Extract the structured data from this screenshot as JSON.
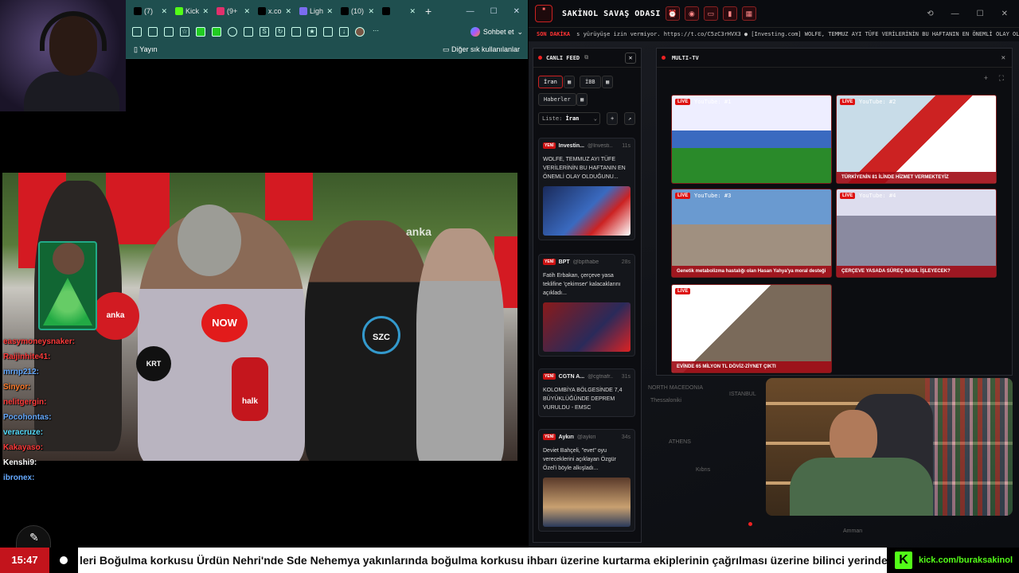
{
  "browser": {
    "tabs": [
      {
        "icon": "x-logo-icon",
        "label": "(7)",
        "color": "#000"
      },
      {
        "icon": "kick-icon",
        "label": "Kick",
        "color": "#53fc18"
      },
      {
        "icon": "instagram-icon",
        "label": "(9+",
        "color": "#e1306c"
      },
      {
        "icon": "x-logo-icon",
        "label": "x.co",
        "color": "#000"
      },
      {
        "icon": "feather-icon",
        "label": "Ligh",
        "color": "#7a6cf0"
      },
      {
        "icon": "x-logo-icon",
        "label": "(10)",
        "color": "#000"
      },
      {
        "icon": "x-logo-icon",
        "label": "",
        "color": "#000"
      }
    ],
    "new_tab": "+",
    "sohbet_label": "Sohbet et",
    "bookmark_left": "Yayın",
    "bookmark_right": "Diğer sık kullanılanlar"
  },
  "video": {
    "watermark": "anka",
    "mics": [
      "NOW",
      "halk",
      "SZC",
      "KRT",
      "anka"
    ]
  },
  "chat": [
    {
      "user": "easymoneysnaker:",
      "color": "#ff3b3b"
    },
    {
      "user": "Raijinhite41:",
      "color": "#ff3b3b"
    },
    {
      "user": "mrnp212:",
      "color": "#66aaff"
    },
    {
      "user": "Sinyor:",
      "color": "#ff7a2a"
    },
    {
      "user": "nelitgergin:",
      "color": "#ff3b3b"
    },
    {
      "user": "Pocohontas:",
      "color": "#66aaff"
    },
    {
      "user": "veracruze:",
      "color": "#55ddff"
    },
    {
      "user": "Kakayaso:",
      "color": "#ff3b3b"
    },
    {
      "user": "Kenshi9:",
      "color": "#ffffff"
    },
    {
      "user": "ibronex:",
      "color": "#66aaff"
    }
  ],
  "app": {
    "title": "SAKİNOL SAVAŞ ODASI",
    "ticker_label": "SON DAKİKA",
    "ticker_text": "s yürüyüşe izin vermiyor. https://t.co/C5zC3rHVX3   ● [Investing.com] WOLFE, TEMMUZ AYI TÜFE VERİLERİNİN BU HAFTANIN EN ÖNEMLİ OLAY OLDUĞUNU",
    "feed": {
      "title": "CANLI FEED",
      "chips": [
        "İran",
        "İBB",
        "Haberler"
      ],
      "list_label": "Liste:",
      "list_value": "İran",
      "cards": [
        {
          "source": "Investin...",
          "handle": "@Investi...",
          "time": "11s",
          "badge": "YENİ",
          "text": "WOLFE, TEMMUZ AYI TÜFE VERİLERİNİN BU HAFTANIN EN ÖNEMLİ OLAY OLDUĞUNU..."
        },
        {
          "source": "BPT",
          "handle": "@bpthaber",
          "time": "28s",
          "badge": "YENİ",
          "text": "Fatih Erbakan, çerçeve yasa teklifine 'çekimser' kalacaklarını açıkladı..."
        },
        {
          "source": "CGTN A...",
          "handle": "@cgtnafr...",
          "time": "31s",
          "badge": "YENİ",
          "text": "KOLOMBİYA BÖLGESİNDE 7,4 BÜYÜKLÜĞÜNDE DEPREM VURULDU - EMSC"
        },
        {
          "source": "Aykırı",
          "handle": "@aykiri",
          "time": "34s",
          "badge": "YENİ",
          "text": "Deviet Bahçeli, \"evet\" oyu vereceklerini açıklayan Özgür Özel'i böyle alkışladı..."
        }
      ]
    },
    "multitv": {
      "title": "MULTI-TV",
      "tiles": [
        {
          "live": "LIVE",
          "title": "YouTube: #1",
          "caption": ""
        },
        {
          "live": "LIVE",
          "title": "YouTube: #2",
          "caption": "TÜRKİYENİN 81 İLİNDE HİZMET VERMEKTEYİZ"
        },
        {
          "live": "LIVE",
          "title": "YouTube: #3",
          "caption": "Genetik metabolizma hastalığı olan Hasan Yahya'ya moral desteği"
        },
        {
          "live": "LIVE",
          "title": "YouTube: #4",
          "caption": "ÇERÇEVE YASADA SÜREÇ NASIL İŞLEYECEK?"
        },
        {
          "live": "LIVE",
          "title": "YouTube: #5",
          "caption": "EVİNDE 65 MİLYON TL DÖVİZ-ZİYNET ÇIKTI"
        }
      ]
    },
    "map_labels": [
      "NORTH MACEDONIA",
      "ISTANBUL",
      "Thessaloniki",
      "ATHENS",
      "Kıbrıs",
      "Amman"
    ]
  },
  "bottom": {
    "clock": "15:47",
    "ticker": "leri Boğulma korkusu Ürdün Nehri'nde Sde Nehemya yakınlarında boğulma korkusu ihbarı üzerine kurtarma ekiplerinin çağrılması üzerine bilinci yerinde ve n",
    "kick_url": "kick.com/buraksakinol"
  }
}
